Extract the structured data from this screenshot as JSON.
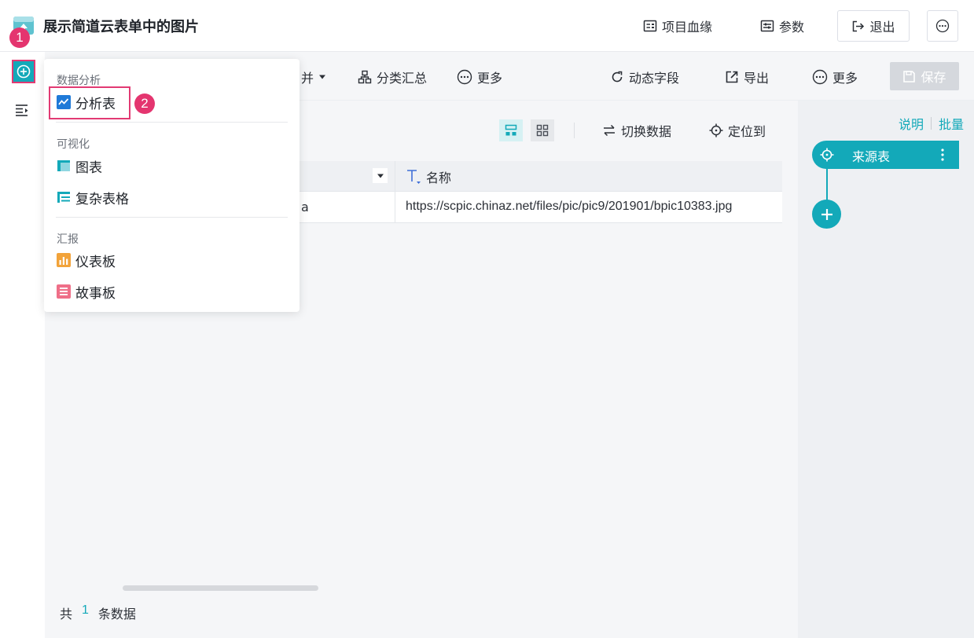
{
  "header": {
    "title": "展示简道云表单中的图片",
    "lineage_label": "项目血缘",
    "params_label": "参数",
    "exit_label": "退出"
  },
  "toolbar": {
    "merge_label": "并",
    "group_summary_label": "分类汇总",
    "more_left_label": "更多",
    "dynamic_field_label": "动态字段",
    "export_label": "导出",
    "more_right_label": "更多",
    "save_label": "保存"
  },
  "preview": {
    "switch_data_label": "切换数据",
    "locate_label": "定位到"
  },
  "table": {
    "columns": [
      {
        "label": ""
      },
      {
        "label": "名称",
        "type_icon": "T"
      }
    ],
    "rows": [
      [
        "a",
        "https://scpic.chinaz.net/files/pic/pic9/201901/bpic10383.jpg"
      ]
    ]
  },
  "footer": {
    "prefix": "共",
    "count": "1",
    "suffix": "条数据"
  },
  "right_panel": {
    "explain_label": "说明",
    "batch_label": "批量",
    "source_node_label": "来源表"
  },
  "menu": {
    "groups": [
      {
        "title": "数据分析",
        "items": [
          {
            "label": "分析表",
            "icon": "analysis-table-icon"
          }
        ]
      },
      {
        "title": "可视化",
        "items": [
          {
            "label": "图表",
            "icon": "chart-icon"
          },
          {
            "label": "复杂表格",
            "icon": "complex-table-icon"
          }
        ]
      },
      {
        "title": "汇报",
        "items": [
          {
            "label": "仪表板",
            "icon": "dashboard-icon"
          },
          {
            "label": "故事板",
            "icon": "storyboard-icon"
          }
        ]
      }
    ]
  },
  "annotations": {
    "step1": "1",
    "step2": "2"
  },
  "colors": {
    "accent": "#13a9b9",
    "highlight": "#e23a73",
    "badge": "#e4356f"
  }
}
